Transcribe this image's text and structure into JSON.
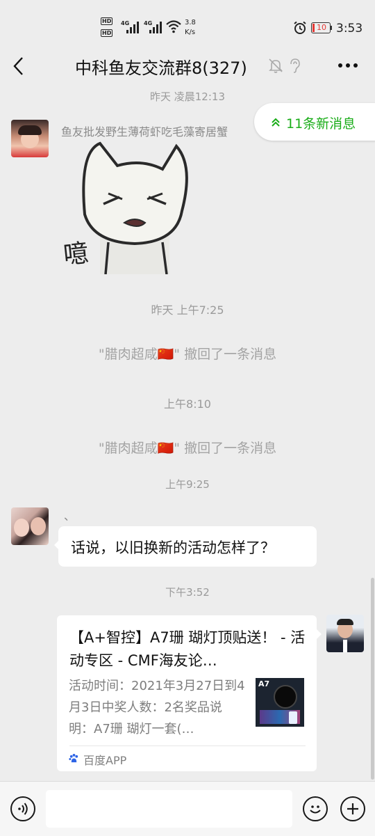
{
  "status_bar": {
    "hd1": "HD",
    "hd2": "HD",
    "net1": "4G",
    "net2": "4G",
    "speed_value": "3.8",
    "speed_unit": "K/s",
    "battery": "10",
    "time": "3:53"
  },
  "header": {
    "title": "中科鱼友交流群8(327)",
    "back_icon": "chevron-left-icon",
    "muted_icon": "bell-off-icon",
    "ear_icon": "ear-icon",
    "more_icon": "more-icon"
  },
  "new_messages": {
    "label": "11条新消息",
    "icon": "double-chevron-up-icon"
  },
  "messages": [
    {
      "type": "timestamp",
      "text": "昨天 凌晨12:13"
    },
    {
      "type": "sticker",
      "sender": "鱼友批发野生薄荷虾吃毛藻寄居蟹",
      "sticker_text": "噫"
    },
    {
      "type": "timestamp",
      "text": "昨天 上午7:25"
    },
    {
      "type": "system",
      "text": "\"腊肉超咸🇨🇳\" 撤回了一条消息"
    },
    {
      "type": "timestamp",
      "text": "上午8:10"
    },
    {
      "type": "system",
      "text": "\"腊肉超咸🇨🇳\" 撤回了一条消息"
    },
    {
      "type": "timestamp",
      "text": "上午9:25"
    },
    {
      "type": "text",
      "sender": "、",
      "text": "话说，以旧换新的活动怎样了？"
    },
    {
      "type": "timestamp",
      "text": "下午3:52"
    },
    {
      "type": "link_card",
      "title": "【A+智控】A7珊 瑚灯顶贴送！ - 活动专区 - CMF海友论…",
      "description": "活动时间：2021年3月27日到4月3日中奖人数：2名奖品说明：A7珊 瑚灯一套(…",
      "thumb_label": "A7",
      "source": "百度APP"
    }
  ],
  "input_bar": {
    "voice_icon": "voice-icon",
    "emoji_icon": "emoji-icon",
    "plus_icon": "plus-icon"
  },
  "colors": {
    "accent_green": "#1aad19",
    "background": "#ededed"
  }
}
